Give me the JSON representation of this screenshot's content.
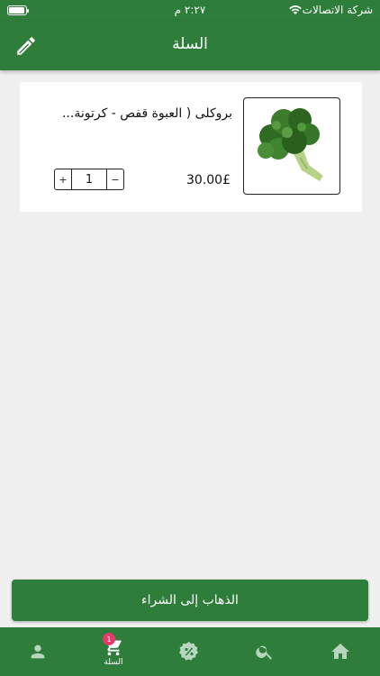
{
  "status_bar": {
    "carrier": "شركة الاتصالات",
    "time": "٢:٢٧ م"
  },
  "app_bar": {
    "title": "السلة",
    "edit_icon": "pencil-icon"
  },
  "cart": {
    "items": [
      {
        "name": "بروكلى ( العبوة قفص - كرتونة...",
        "price": "30.00£",
        "quantity": "1",
        "image_icon": "broccoli-image"
      }
    ]
  },
  "checkout_label": "الذهاب إلى الشراء",
  "bottom_nav": {
    "cart_label": "السلة",
    "cart_badge": "1",
    "icons": [
      "profile-icon",
      "cart-icon",
      "offers-icon",
      "search-icon",
      "home-icon"
    ]
  },
  "colors": {
    "primary": "#2e7d3a",
    "badge": "#e53968",
    "background": "#f0f0f0"
  }
}
